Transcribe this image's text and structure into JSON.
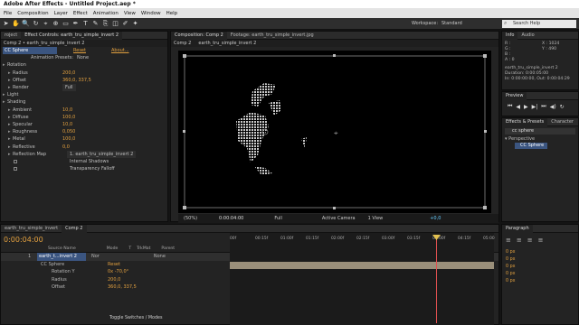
{
  "app": {
    "title": "Adobe After Effects - Untitled Project.aep *"
  },
  "menu": [
    "File",
    "Composition",
    "Layer",
    "Effect",
    "Animation",
    "View",
    "Window",
    "Help"
  ],
  "workspace": {
    "label": "Workspace:",
    "value": "Standard"
  },
  "search_help": {
    "placeholder": "Search Help"
  },
  "effect_controls": {
    "tabs": [
      "roject",
      "Effect Controls: earth_tru_simple_invert 2"
    ],
    "breadcrumb": "Comp 2 • earth_tru_simple_invert 2",
    "effect_name": "CC Sphere",
    "reset": "Reset",
    "about": "About...",
    "presets_label": "Animation Presets:",
    "presets_value": "None",
    "rows": [
      {
        "label": "Rotation",
        "value": "",
        "indent": 0,
        "group": true
      },
      {
        "label": "Radius",
        "value": "200,0",
        "indent": 1
      },
      {
        "label": "Offset",
        "value": "360,0, 337,5",
        "indent": 1
      },
      {
        "label": "Render",
        "value": "Full",
        "indent": 1
      },
      {
        "label": "Light",
        "value": "",
        "indent": 0,
        "group": true
      },
      {
        "label": "Shading",
        "value": "",
        "indent": 0,
        "group": true
      },
      {
        "label": "Ambient",
        "value": "10,0",
        "indent": 1
      },
      {
        "label": "Diffuse",
        "value": "100,0",
        "indent": 1
      },
      {
        "label": "Specular",
        "value": "10,0",
        "indent": 1
      },
      {
        "label": "Roughness",
        "value": "0,050",
        "indent": 1
      },
      {
        "label": "Metal",
        "value": "100,0",
        "indent": 1
      },
      {
        "label": "Reflective",
        "value": "0,0",
        "indent": 1
      },
      {
        "label": "Reflection Map",
        "value": "1. earth_tru_simple_invert 2",
        "indent": 1
      },
      {
        "label": "",
        "value": "Internal Shadows",
        "indent": 2,
        "check": true
      },
      {
        "label": "",
        "value": "Transparency Falloff",
        "indent": 2,
        "check": true
      }
    ]
  },
  "composition": {
    "tabs": [
      "Composition: Comp 2",
      "Footage: earth_tru_simple_invert.jpg"
    ],
    "subtabs": [
      "Comp 2",
      "earth_tru_simple_invert 2"
    ],
    "zoom": "(50%)",
    "timecode": "0:00:04:00",
    "resolution": "Full",
    "camera": "Active Camera",
    "view": "1 View",
    "exposure": "+0,0"
  },
  "info": {
    "tabs": [
      "Info",
      "Audio"
    ],
    "r": "R :",
    "g": "G :",
    "b": "B :",
    "a": "A : 0",
    "x": "X : 1024",
    "y": "Y : 490",
    "layer": "earth_tru_simple_invert 2",
    "duration": "Duration: 0:00:05:00",
    "inout": "In: 0:00:00:00, Out: 0:00:04:29"
  },
  "preview": {
    "tab": "Preview"
  },
  "effects_presets": {
    "tabs": [
      "Effects & Presets",
      "Character"
    ],
    "search": "cc sphere",
    "category": "Perspective",
    "item": "CC Sphere"
  },
  "timeline": {
    "tabs": [
      "earth_tru_simple_invert",
      "Comp 2"
    ],
    "timecode": "0:00:04:00",
    "columns": [
      "Source Name",
      "Mode",
      "T",
      "TrkMat",
      "Parent"
    ],
    "layer": {
      "num": "1",
      "name": "earth_t...invert 2",
      "mode": "Nor",
      "parent": "None"
    },
    "rows": [
      {
        "label": "CC Sphere",
        "value": "Reset"
      },
      {
        "label": "Rotation Y",
        "value": "0x -70,0°"
      },
      {
        "label": "Radius",
        "value": "200,0"
      },
      {
        "label": "Offset",
        "value": "360,0, 337,5"
      }
    ],
    "ruler": [
      "00f",
      "00:15f",
      "01:00f",
      "01:15f",
      "02:00f",
      "02:15f",
      "03:00f",
      "03:15f",
      "04:00f",
      "04:15f",
      "05:00"
    ],
    "toggle": "Toggle Switches / Modes"
  },
  "paragraph": {
    "tab": "Paragraph",
    "fields": [
      "0 px",
      "0 px",
      "0 px",
      "0 px",
      "0 px"
    ]
  }
}
